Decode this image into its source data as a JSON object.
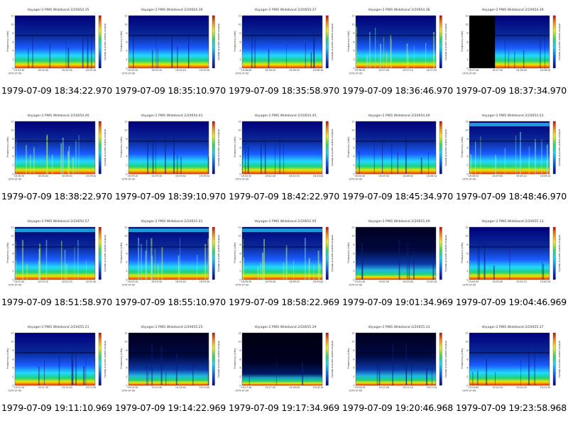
{
  "page": {
    "columns": 5,
    "rows": 4
  },
  "colors": {
    "background": "#ffffff",
    "spectrogram_low": "#00007a",
    "spectrogram_mid": "#1a5cff",
    "spectrogram_high": "#22d8ff",
    "band_green": "#1fd27a",
    "band_yellow": "#e8e800",
    "band_red": "#ff2a00"
  },
  "thumbnails": [
    {
      "title": "Voyager-2 PWS Wideband 2/20654.35",
      "caption": "1979-07-09 18:34:22.970",
      "times": [
        "18:34:30",
        "18:34:40",
        "18:34:50",
        "18:35:10"
      ]
    },
    {
      "title": "Voyager-2 PWS Wideband 2/20654.36",
      "caption": "1979-07-09 18:35:10.970",
      "times": [
        "18:35:20",
        "18:35:30",
        "18:35:40",
        "18:35:50"
      ]
    },
    {
      "title": "Voyager-2 PWS Wideband 2/20654.37",
      "caption": "1979-07-09 18:35:58.970",
      "times": [
        "18:36:00",
        "18:36:10",
        "18:36:20",
        "18:36:40"
      ]
    },
    {
      "title": "Voyager-2 PWS Wideband 2/20654.38",
      "caption": "1979-07-09 18:36:46.970",
      "times": [
        "18:36:50",
        "18:37:00",
        "18:37:10",
        "18:37:20"
      ]
    },
    {
      "title": "Voyager-2 PWS Wideband 2/20654.39",
      "caption": "1979-07-09 18:37:34.970",
      "times": [
        "18:37:40",
        "18:37:50",
        "18:38:00",
        "18:38:20"
      ]
    },
    {
      "title": "Voyager-2 PWS Wideband 2/20654.40",
      "caption": "1979-07-09 18:38:22.970",
      "times": [
        "18:38:30",
        "18:38:40",
        "18:38:50",
        "18:39:00"
      ]
    },
    {
      "title": "Voyager-2 PWS Wideband 2/20654.41",
      "caption": "1979-07-09 18:39:10.970",
      "times": [
        "18:39:20",
        "18:39:30",
        "18:39:40",
        "18:39:50"
      ]
    },
    {
      "title": "Voyager-2 PWS Wideband 2/20654.45",
      "caption": "1979-07-09 18:42:22.970",
      "times": [
        "18:42:30",
        "18:42:40",
        "18:42:50",
        "18:43:00"
      ]
    },
    {
      "title": "Voyager-2 PWS Wideband 2/20654.49",
      "caption": "1979-07-09 18:45:34.970",
      "times": [
        "18:45:40",
        "18:45:50",
        "18:46:00",
        "18:46:10"
      ]
    },
    {
      "title": "Voyager-2 PWS Wideband 2/20654.53",
      "caption": "1979-07-09 18:48:46.970",
      "times": [
        "18:48:50",
        "18:49:00",
        "18:49:10",
        "18:49:20"
      ]
    },
    {
      "title": "Voyager-2 PWS Wideband 2/20654.57",
      "caption": "1979-07-09 18:51:58.970",
      "times": [
        "18:52:00",
        "18:52:10",
        "18:52:20",
        "18:52:40"
      ]
    },
    {
      "title": "Voyager-2 PWS Wideband 2/20655.01",
      "caption": "1979-07-09 18:55:10.970",
      "times": [
        "18:55:20",
        "18:55:30",
        "18:55:40",
        "18:55:50"
      ]
    },
    {
      "title": "Voyager-2 PWS Wideband 2/20655.05",
      "caption": "1979-07-09 18:58:22.969",
      "times": [
        "18:58:30",
        "18:58:40",
        "18:58:50",
        "18:59:00"
      ]
    },
    {
      "title": "Voyager-2 PWS Wideband 2/20655.09",
      "caption": "1979-07-09 19:01:34.969",
      "times": [
        "19:01:40",
        "19:01:50",
        "19:02:00",
        "19:02:10"
      ]
    },
    {
      "title": "Voyager-2 PWS Wideband 2/20655.13",
      "caption": "1979-07-09 19:04:46.969",
      "times": [
        "19:04:50",
        "19:05:00",
        "19:05:10",
        "19:05:20"
      ]
    },
    {
      "title": "Voyager-2 PWS Wideband 2/20655.21",
      "caption": "1979-07-09 19:11:10.969",
      "times": [
        "19:11:20",
        "19:11:30",
        "19:11:40",
        "19:11:50"
      ]
    },
    {
      "title": "Voyager-2 PWS Wideband 2/20655.25",
      "caption": "1979-07-09 19:14:22.969",
      "times": [
        "19:14:30",
        "19:14:40",
        "19:14:50",
        "19:15:00"
      ]
    },
    {
      "title": "Voyager-2 PWS Wideband 2/20655.29",
      "caption": "1979-07-09 19:17:34.969",
      "times": [
        "19:17:40",
        "19:17:50",
        "19:18:00",
        "19:18:10"
      ]
    },
    {
      "title": "Voyager-2 PWS Wideband 2/20655.33",
      "caption": "1979-07-09 19:20:46.968",
      "times": [
        "19:20:50",
        "19:21:00",
        "19:21:10",
        "19:21:20"
      ]
    },
    {
      "title": "Voyager-2 PWS Wideband 2/20655.37",
      "caption": "1979-07-09 19:23:58.968",
      "times": [
        "19:24:00",
        "19:24:10",
        "19:24:20",
        "19:24:30"
      ]
    }
  ],
  "chart_data": {
    "type": "heatmap",
    "ylabel": "Frequency (kHz)",
    "colorbar_label": "relative power spectral density",
    "ylim": [
      0,
      12
    ],
    "y_ticks": [
      "0",
      "2",
      "4",
      "6",
      "8",
      "10",
      "12"
    ],
    "x_date_label": "1979-07-09",
    "grid": false,
    "legend": "colorbar-right",
    "variants": [
      "normal",
      "normal",
      "normal",
      "bursty",
      "blackout",
      "bursty",
      "normal",
      "normal",
      "normal",
      "strong",
      "strong",
      "strong",
      "strong",
      "dark",
      "normal",
      "normal",
      "dark",
      "verydark",
      "dark",
      "normal"
    ]
  }
}
